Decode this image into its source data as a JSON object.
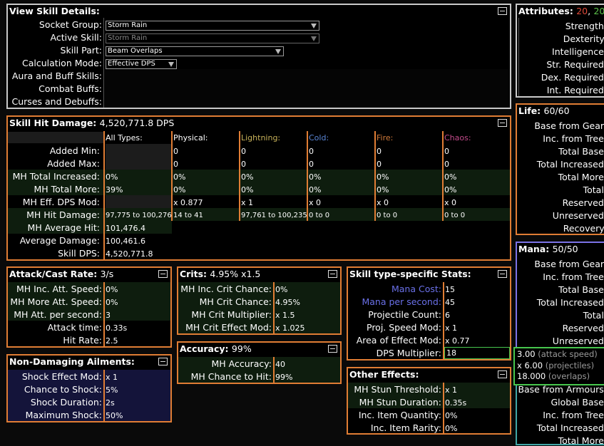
{
  "colors": {
    "lightning": "#c8b25a",
    "cold": "#5a86d6",
    "fire": "#d07a3a",
    "chaos": "#c24a8a",
    "accent": "#e07d34",
    "str": "#e04a3a",
    "dex": "#5cc24a",
    "mana_label": "#6a70e8"
  },
  "view_skill": {
    "title": "View Skill Details:",
    "labels": [
      "Socket Group:",
      "Active Skill:",
      "Skill Part:",
      "Calculation Mode:",
      "Aura and Buff Skills:",
      "Combat Buffs:",
      "Curses and Debuffs:"
    ],
    "socket_group": "Storm Rain",
    "active_skill": "Storm Rain",
    "skill_part": "Beam Overlaps",
    "calc_mode": "Effective DPS"
  },
  "attributes": {
    "title": "Attributes:",
    "str": "20",
    "sep": ",",
    "dex": "20",
    "rows": [
      "Strength:",
      "Dexterity:",
      "Intelligence:",
      "Str. Required:",
      "Dex. Required:",
      "Int. Required:"
    ]
  },
  "life": {
    "title": "Life:",
    "value": "60/60",
    "rows": [
      "Base from Gear:",
      "Inc. from Tree:",
      "Total Base:",
      "Total Increased:",
      "Total More:",
      "Total:",
      "Reserved:",
      "Unreserved:",
      "Recovery:"
    ]
  },
  "mana": {
    "title": "Mana:",
    "value": "50/50",
    "rows": [
      "Base from Gear:",
      "Inc. from Tree:",
      "Total Base:",
      "Total Increased:",
      "Total:",
      "Reserved:",
      "Unreserved:"
    ]
  },
  "es_rows": [
    "Base from Armours:",
    "Global Base:",
    "Inc. from Tree:",
    "Total Increased:",
    "Total More:"
  ],
  "hit_damage": {
    "title": "Skill Hit Damage:",
    "value": "4,520,771.8 DPS",
    "columns": [
      "All Types:",
      "Physical:",
      "Lightning:",
      "Cold:",
      "Fire:",
      "Chaos:"
    ],
    "rows": [
      {
        "label": "Added Min:",
        "cells": [
          "",
          "0",
          "0",
          "0",
          "0",
          "0"
        ]
      },
      {
        "label": "Added Max:",
        "cells": [
          "",
          "0",
          "0",
          "0",
          "0",
          "0"
        ]
      },
      {
        "label": "MH Total Increased:",
        "cells": [
          "0%",
          "0%",
          "0%",
          "0%",
          "0%",
          "0%"
        ]
      },
      {
        "label": "MH Total More:",
        "cells": [
          "39%",
          "0%",
          "0%",
          "0%",
          "0%",
          "0%"
        ]
      },
      {
        "label": "MH Eff. DPS Mod:",
        "cells": [
          "",
          "x 0.877",
          "x 1",
          "x 0",
          "x 0",
          "x 0"
        ]
      },
      {
        "label": "MH Hit Damage:",
        "cells": [
          "97,775 to 100,276",
          "14 to 41",
          "97,761 to 100,235",
          "0 to 0",
          "0 to 0",
          "0 to 0"
        ]
      },
      {
        "label": "MH Average Hit:",
        "cells": [
          "101,476.4"
        ]
      },
      {
        "label": "Average Damage:",
        "cells": [
          "100,461.6"
        ]
      },
      {
        "label": "Skill DPS:",
        "cells": [
          "4,520,771.8"
        ]
      }
    ]
  },
  "attack_rate": {
    "title": "Attack/Cast Rate:",
    "value": "3/s",
    "rows": [
      {
        "label": "MH Inc. Att. Speed:",
        "value": "0%"
      },
      {
        "label": "MH More Att. Speed:",
        "value": "0%"
      },
      {
        "label": "MH Att. per second:",
        "value": "3"
      },
      {
        "label": "Attack time:",
        "value": "0.33s"
      },
      {
        "label": "Hit Rate:",
        "value": "2.5"
      }
    ]
  },
  "crits": {
    "title": "Crits:",
    "value": "4.95% x1.5",
    "rows": [
      {
        "label": "MH Inc. Crit Chance:",
        "value": "0%"
      },
      {
        "label": "MH Crit Chance:",
        "value": "4.95%"
      },
      {
        "label": "MH Crit Multiplier:",
        "value": "x 1.5"
      },
      {
        "label": "MH Crit Effect Mod:",
        "value": "x 1.025"
      }
    ]
  },
  "skill_stats": {
    "title": "Skill type-specific Stats:",
    "rows": [
      {
        "label": "Mana Cost:",
        "value": "15",
        "blue": true
      },
      {
        "label": "Mana per second:",
        "value": "45",
        "blue": true
      },
      {
        "label": "Projectile Count:",
        "value": "6"
      },
      {
        "label": "Proj. Speed Mod:",
        "value": "x 1"
      },
      {
        "label": "Area of Effect Mod:",
        "value": "x 0.77"
      },
      {
        "label": "DPS Multiplier:",
        "value": "18"
      }
    ]
  },
  "ailments": {
    "title": "Non-Damaging Ailments:",
    "rows": [
      {
        "label": "Shock Effect Mod:",
        "value": "x 1"
      },
      {
        "label": "Chance to Shock:",
        "value": "5%"
      },
      {
        "label": "Shock Duration:",
        "value": "2s"
      },
      {
        "label": "Maximum Shock:",
        "value": "50%"
      }
    ]
  },
  "accuracy": {
    "title": "Accuracy:",
    "value": "99%",
    "rows": [
      {
        "label": "MH Accuracy:",
        "value": "40"
      },
      {
        "label": "MH Chance to Hit:",
        "value": "99%"
      }
    ]
  },
  "other_effects": {
    "title": "Other Effects:",
    "rows": [
      {
        "label": "MH Stun Threshold:",
        "value": "x 1"
      },
      {
        "label": "MH Stun Duration:",
        "value": "0.35s"
      },
      {
        "label": "Inc. Item Quantity:",
        "value": "0%"
      },
      {
        "label": "Inc. Item Rarity:",
        "value": "0%"
      }
    ]
  },
  "tooltip": {
    "lines": [
      {
        "num": "3.00",
        "note": "(attack speed)"
      },
      {
        "num": "x 6.00",
        "note": "(projectiles)"
      },
      {
        "num": "18.000",
        "note": "(overlaps)"
      }
    ]
  }
}
